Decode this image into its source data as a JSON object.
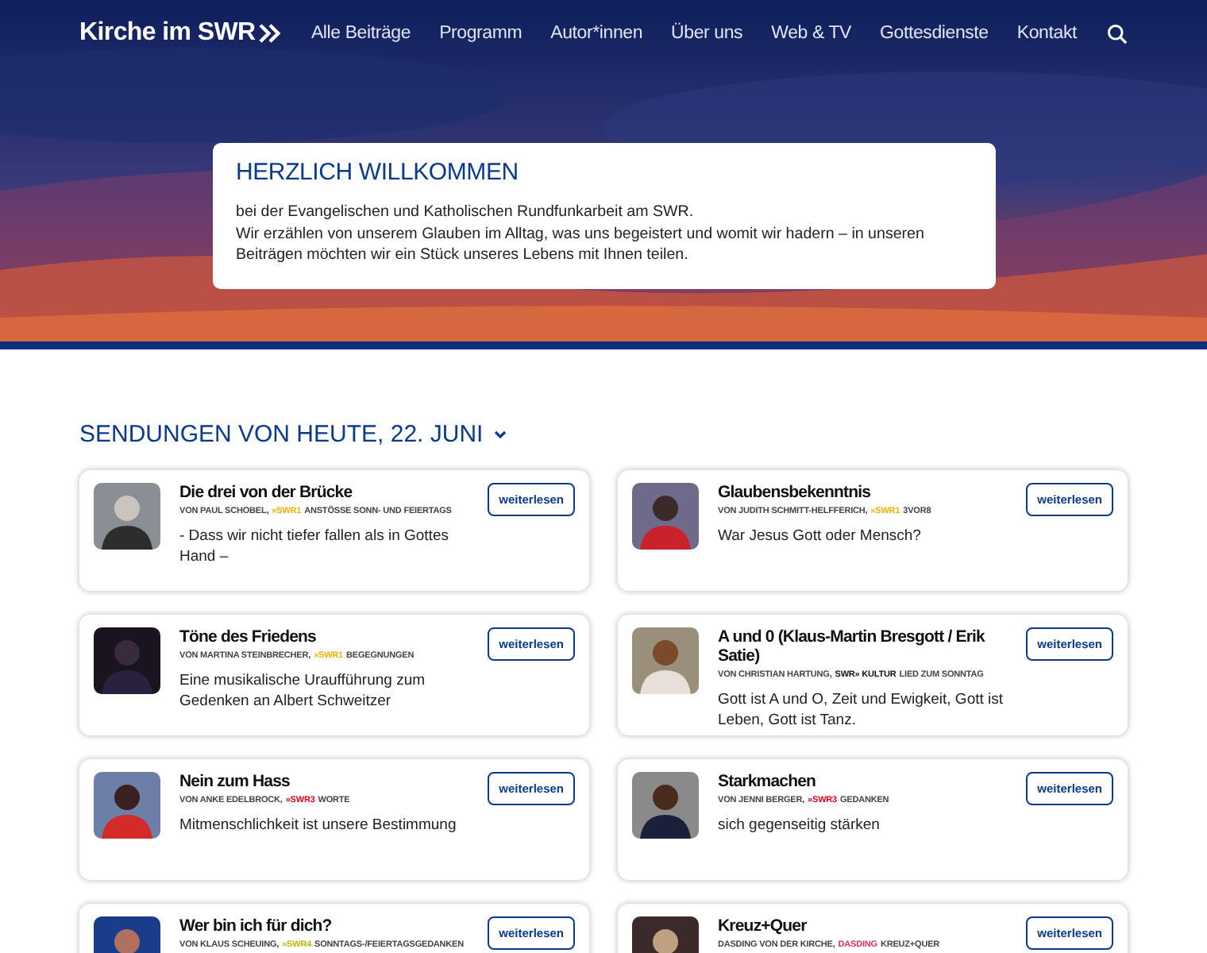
{
  "logo": {
    "text": "Kirche im SWR"
  },
  "nav": {
    "items": [
      "Alle Beiträge",
      "Programm",
      "Autor*innen",
      "Über uns",
      "Web & TV",
      "Gottesdienste",
      "Kontakt"
    ]
  },
  "welcome": {
    "title": "HERZLICH WILLKOMMEN",
    "lines": [
      "bei der Evangelischen und Katholischen Rundfunkarbeit am SWR.",
      "Wir erzählen von unserem Glauben im Alltag, was uns begeistert und womit wir hadern – in unseren Beiträgen möchten wir ein Stück unseres Lebens mit Ihnen teilen."
    ]
  },
  "section": {
    "title": "SENDUNGEN VON HEUTE, 22. JUNI"
  },
  "cards": [
    {
      "title": "Die drei von der Brücke",
      "author": "VON PAUL SCHOBEL,",
      "station": {
        "label": "»SWR1",
        "color": "#f2b100"
      },
      "program": "ANSTÖSSE SONN- UND FEIERTAGS",
      "teaser": "- Dass wir nicht tiefer fallen als in Gottes Hand –",
      "button": "weiterlesen"
    },
    {
      "title": "Glaubensbekenntnis",
      "author": "VON JUDITH SCHMITT-HELFFERICH,",
      "station": {
        "label": "»SWR1",
        "color": "#f2b100"
      },
      "program": "3VOR8",
      "teaser": "War Jesus Gott oder Mensch?",
      "button": "weiterlesen"
    },
    {
      "title": "Töne des Friedens",
      "author": "VON MARTINA STEINBRECHER,",
      "station": {
        "label": "»SWR1",
        "color": "#f2b100"
      },
      "program": "BEGEGNUNGEN",
      "teaser": "Eine musikalische Uraufführung zum Gedenken an Albert Schweitzer",
      "button": "weiterlesen"
    },
    {
      "title": "A und 0 (Klaus-Martin Bresgott / Erik Satie)",
      "author": "VON CHRISTIAN HARTUNG,",
      "station": {
        "label": "SWR» KULTUR",
        "color": "#111111"
      },
      "program": "LIED ZUM SONNTAG",
      "teaser": "Gott ist A und O, Zeit und Ewigkeit, Gott ist Leben, Gott ist Tanz.",
      "button": "weiterlesen"
    },
    {
      "title": "Nein zum Hass",
      "author": "VON ANKE EDELBROCK,",
      "station": {
        "label": "»SWR3",
        "color": "#e2001a"
      },
      "program": "WORTE",
      "teaser": "Mitmenschlichkeit ist unsere Bestimmung",
      "button": "weiterlesen"
    },
    {
      "title": "Starkmachen",
      "author": "VON JENNI BERGER,",
      "station": {
        "label": "»SWR3",
        "color": "#e2001a"
      },
      "program": "GEDANKEN",
      "teaser": "sich gegenseitig stärken",
      "button": "weiterlesen"
    },
    {
      "title": "Wer bin ich für dich?",
      "author": "VON KLAUS SCHEUING,",
      "station": {
        "label": "»SWR4",
        "color": "#c8b400"
      },
      "program": "SONNTAGS-/FEIERTAGSGEDANKEN",
      "button": "weiterlesen"
    },
    {
      "title": "Kreuz+Quer",
      "author": "DASDING VON DER KIRCHE,",
      "station": {
        "label": "DASDING",
        "color": "#e0306a"
      },
      "program": "KREUZ+QUER",
      "button": "weiterlesen"
    }
  ]
}
